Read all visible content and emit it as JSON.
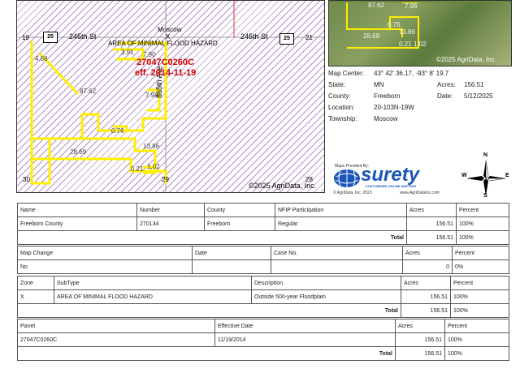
{
  "map": {
    "road_top_left": "245th St",
    "road_top_right": "245th St",
    "road_side": "865th Ave",
    "route_shield": "25",
    "town": "Moscow",
    "town_marker": "X",
    "flood_zone_label": "AREA OF MINIMAL FLOOD HAZARD",
    "panel_label": "27047C0260C",
    "eff_label": "eff. 2014-11-19",
    "section_19": "19",
    "section_20": "20",
    "section_21": "21",
    "section_30": "30",
    "section_29": "29",
    "section_28": "28",
    "copyright": "©2025 AgriData, Inc.",
    "field_labels": [
      "4.68",
      "3.91",
      "7.90",
      "87.62",
      "7.98",
      "0.76",
      "13.86",
      "28.69",
      "0.21",
      "1.02"
    ]
  },
  "aerial": {
    "field_labels": [
      "87.62",
      "7.96",
      "0.76",
      "28.69",
      "13.86",
      "0.21",
      "1.02"
    ],
    "copyright": "©2025 AgriData, Inc."
  },
  "info": {
    "map_center_label": "Map Center:",
    "map_center_value": "43° 42' 36.17, -93° 8' 19.7",
    "state_label": "State:",
    "state_value": "MN",
    "acres_label": "Acres:",
    "acres_value": "156.51",
    "county_label": "County:",
    "county_value": "Freeborn",
    "date_label": "Date:",
    "date_value": "5/12/2025",
    "location_label": "Location:",
    "location_value": "20-103N-19W",
    "township_label": "Township:",
    "township_value": "Moscow"
  },
  "logo": {
    "provided_by": "Maps Provided By:",
    "brand": "surety",
    "tagline": "CUSTOMIZED ONLINE MAPPING",
    "credit_left": "© AgriData, Inc. 2023",
    "credit_right": "www.AgriDataInc.com"
  },
  "compass": {
    "n": "N",
    "s": "S",
    "e": "E",
    "w": "W"
  },
  "table1": {
    "headers": [
      "Name",
      "Number",
      "County",
      "NFIP Participation",
      "Acres",
      "Percent"
    ],
    "row": [
      "Freeborn County",
      "270134",
      "Freeborn",
      "Regular",
      "156.51",
      "100%"
    ],
    "total_label": "Total",
    "total_acres": "156.51",
    "total_percent": "100%"
  },
  "table2": {
    "headers": [
      "Map Change",
      "Date",
      "Case No.",
      "Acres",
      "Percent"
    ],
    "row": [
      "No",
      "",
      "",
      "0",
      "0%"
    ]
  },
  "table3": {
    "headers": [
      "Zone",
      "SubType",
      "Description",
      "Acres",
      "Percent"
    ],
    "row": [
      "X",
      "AREA OF MINIMAL FLOOD HAZARD",
      "Outside 500-year Floodplain",
      "156.51",
      "100%"
    ],
    "total_label": "Total",
    "total_acres": "156.51",
    "total_percent": "100%"
  },
  "table4": {
    "headers": [
      "Panel",
      "Effective Date",
      "Acres",
      "Percent"
    ],
    "row": [
      "27047C0260C",
      "11/19/2014",
      "156.51",
      "100%"
    ],
    "total_label": "Total",
    "total_acres": "156.51",
    "total_percent": "100%"
  },
  "colors": {
    "parcel": "#ffee00",
    "panel_text": "#d10000",
    "hatch": "#b48fc8",
    "brand": "#1a56b8"
  }
}
